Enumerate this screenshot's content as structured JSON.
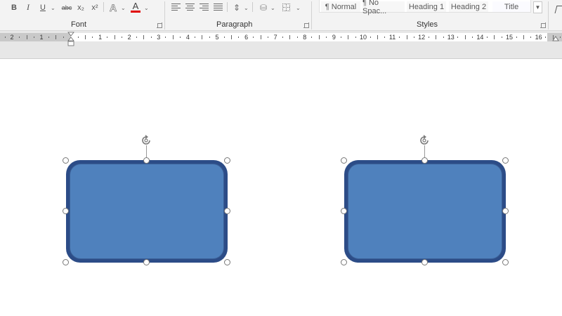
{
  "ribbon": {
    "font_group": {
      "label": "Font",
      "bold": "B",
      "italic": "I",
      "underline": "U",
      "strikethrough": "abc",
      "subscript": "x₂",
      "superscript": "x²",
      "text_effects": "A",
      "font_color": "A",
      "font_color_value": "#e00000"
    },
    "paragraph_group": {
      "label": "Paragraph"
    },
    "styles_group": {
      "label": "Styles",
      "items": [
        "¶ Normal",
        "¶ No Spac...",
        "Heading 1",
        "Heading 2",
        "Title"
      ]
    }
  },
  "ruler": {
    "numbers_left": [
      "2",
      "1"
    ],
    "numbers_right": [
      "1",
      "2",
      "3",
      "4",
      "5",
      "6",
      "7",
      "8",
      "9",
      "10",
      "11",
      "12",
      "13",
      "14",
      "15",
      "16"
    ]
  },
  "shapes": [
    {
      "name": "rounded-rectangle-1",
      "fill": "#4f81bd",
      "outline": "#1f3b73",
      "selected": true
    },
    {
      "name": "rounded-rectangle-2",
      "fill": "#4f81bd",
      "outline": "#1f3b73",
      "selected": true
    }
  ]
}
